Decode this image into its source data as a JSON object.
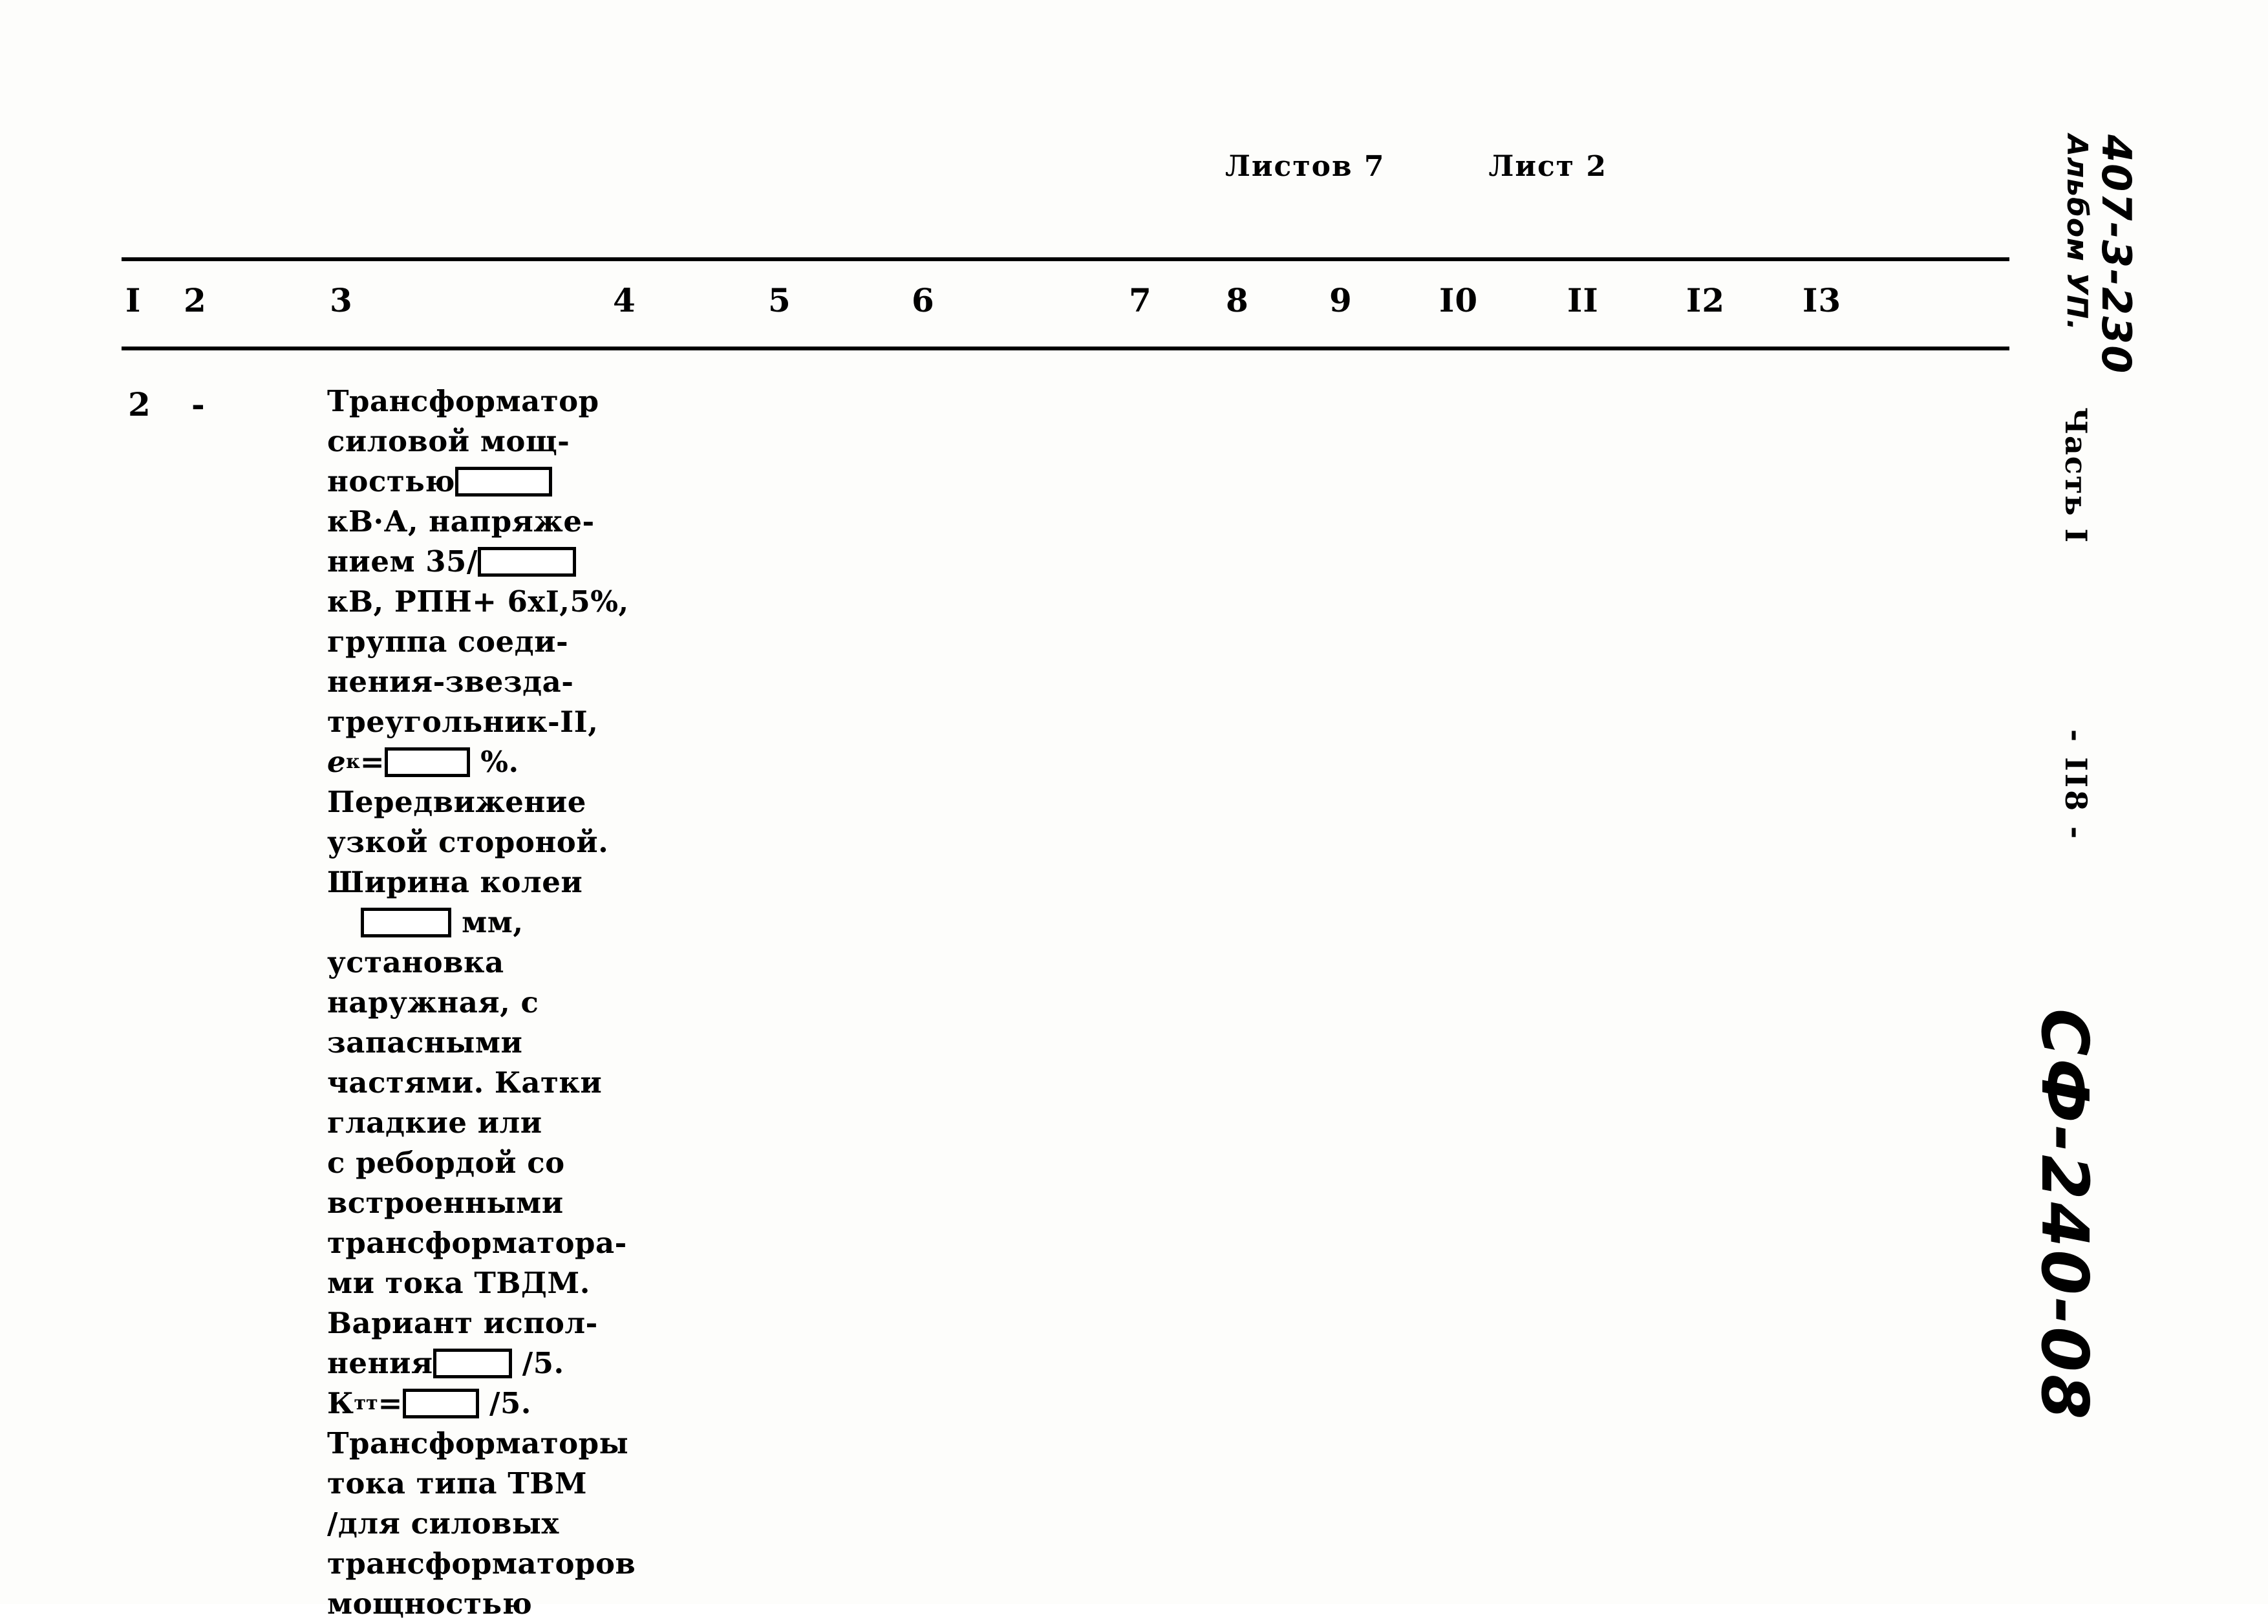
{
  "sheet_header": {
    "sheets_total_label": "Листов 7",
    "sheet_current_label": "Лист 2"
  },
  "table": {
    "column_headers": [
      "I",
      "2",
      "3",
      "4",
      "5",
      "6",
      "7",
      "8",
      "9",
      "I0",
      "II",
      "I2",
      "I3"
    ],
    "row": {
      "col1": "2",
      "col2": "-",
      "col3_lines": [
        {
          "text": "Трансформатор"
        },
        {
          "text": "силовой мощ-"
        },
        {
          "text": "ностью",
          "box": true
        },
        {
          "text": "кВ·А, напряже-"
        },
        {
          "text": "нием 35/",
          "box": true
        },
        {
          "text": "кВ, РПН+ 6хI,5%,"
        },
        {
          "text": "группа соеди-"
        },
        {
          "text": "нения-звезда-"
        },
        {
          "text": "треугольник-II,"
        },
        {
          "pre": "e",
          "sub": "к",
          "text": "=",
          "box": true,
          "post": "%."
        },
        {
          "text": "Передвижение"
        },
        {
          "text": "узкой стороной."
        },
        {
          "text": "Ширина колеи"
        },
        {
          "box_only": true,
          "post": "мм,"
        },
        {
          "text": "установка"
        },
        {
          "text": "наружная, с"
        },
        {
          "text": "запасными"
        },
        {
          "text": "частями. Катки"
        },
        {
          "text": "гладкие или"
        },
        {
          "text": "с ребордой со"
        },
        {
          "text": "встроенными"
        },
        {
          "text": "трансформатора-"
        },
        {
          "text": "ми тока ТВДМ."
        },
        {
          "text": "Вариант испол-"
        },
        {
          "text": "нения",
          "box": true,
          "post": "/5."
        },
        {
          "pre": "К",
          "sub": "тт",
          "text": "=",
          "box": true,
          "post": "/5."
        },
        {
          "text": "Трансформаторы"
        },
        {
          "text": "тока типа ТВМ"
        },
        {
          "text": "/для силовых"
        },
        {
          "text": "трансформаторов"
        },
        {
          "text": "мощностью"
        }
      ]
    }
  },
  "margin": {
    "project_code": "407-3-230",
    "album": "Альбом УП.",
    "part": "Часть I",
    "page_number": "- II8 -",
    "archive_code": "СФ-240-08"
  }
}
